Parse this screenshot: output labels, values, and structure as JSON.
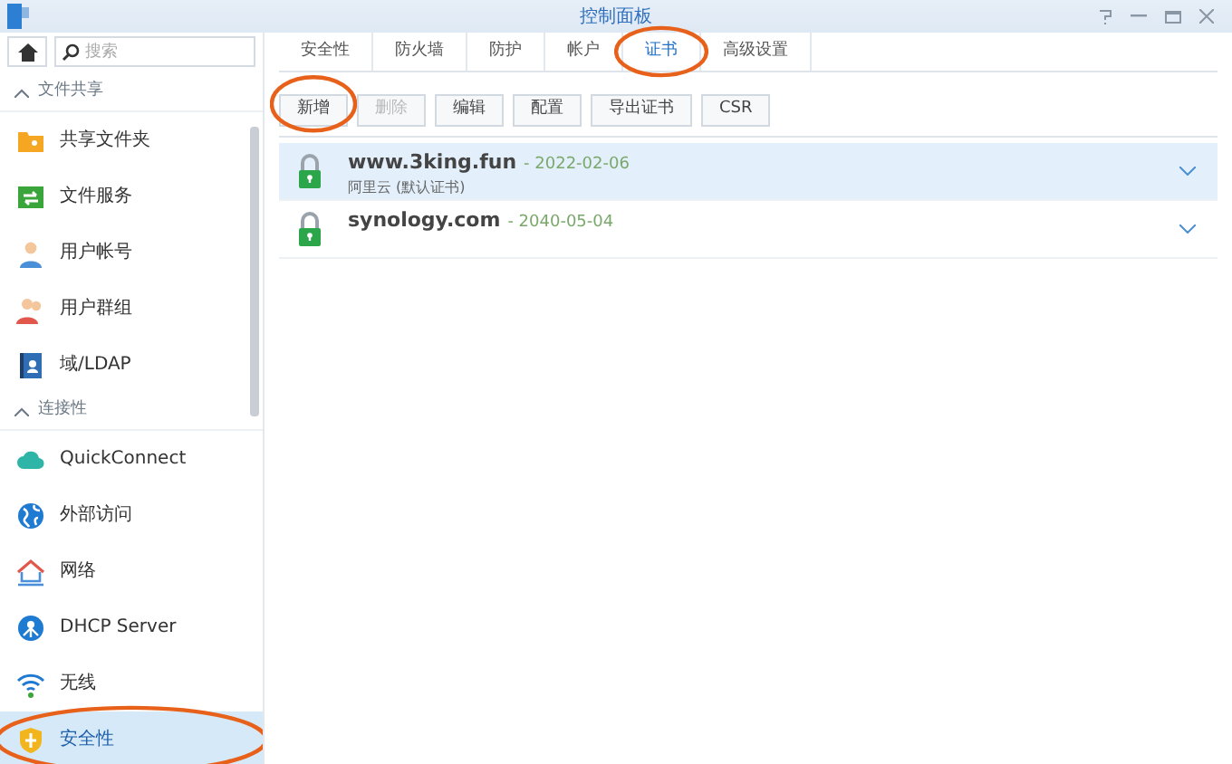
{
  "window": {
    "title": "控制面板"
  },
  "sidebar": {
    "search": {
      "placeholder": "搜索"
    },
    "sections": [
      {
        "title": "文件共享",
        "expanded": true,
        "items": [
          {
            "label": "共享文件夹",
            "kind": "folder",
            "selected": false,
            "circled": false
          },
          {
            "label": "文件服务",
            "kind": "transfer",
            "selected": false,
            "circled": false
          },
          {
            "label": "用户帐号",
            "kind": "user",
            "selected": false,
            "circled": false
          },
          {
            "label": "用户群组",
            "kind": "group",
            "selected": false,
            "circled": false
          },
          {
            "label": "域/LDAP",
            "kind": "ldap",
            "selected": false,
            "circled": false
          }
        ]
      },
      {
        "title": "连接性",
        "expanded": true,
        "items": [
          {
            "label": "QuickConnect",
            "kind": "cloud",
            "selected": false,
            "circled": false
          },
          {
            "label": "外部访问",
            "kind": "globe",
            "selected": false,
            "circled": false
          },
          {
            "label": "网络",
            "kind": "house",
            "selected": false,
            "circled": false
          },
          {
            "label": "DHCP Server",
            "kind": "dhcp",
            "selected": false,
            "circled": false
          },
          {
            "label": "无线",
            "kind": "wifi",
            "selected": false,
            "circled": false
          },
          {
            "label": "安全性",
            "kind": "shield",
            "selected": true,
            "circled": true
          }
        ]
      }
    ]
  },
  "tabs": [
    {
      "label": "安全性",
      "selected": false,
      "circled": false
    },
    {
      "label": "防火墙",
      "selected": false,
      "circled": false
    },
    {
      "label": "防护",
      "selected": false,
      "circled": false
    },
    {
      "label": "帐户",
      "selected": false,
      "circled": false
    },
    {
      "label": "证书",
      "selected": true,
      "circled": true
    },
    {
      "label": "高级设置",
      "selected": false,
      "circled": false
    }
  ],
  "toolbar": [
    {
      "label": "新增",
      "disabled": false,
      "circled": true
    },
    {
      "label": "删除",
      "disabled": true,
      "circled": false
    },
    {
      "label": "编辑",
      "disabled": false,
      "circled": false
    },
    {
      "label": "配置",
      "disabled": false,
      "circled": false
    },
    {
      "label": "导出证书",
      "disabled": false,
      "circled": false
    },
    {
      "label": "CSR",
      "disabled": false,
      "circled": false
    }
  ],
  "certificates": [
    {
      "name": "www.3king.fun",
      "date": "- 2022-02-06",
      "note": "阿里云 (默认证书)",
      "selected": true
    },
    {
      "name": "synology.com",
      "date": "- 2040-05-04",
      "selected": false
    }
  ]
}
